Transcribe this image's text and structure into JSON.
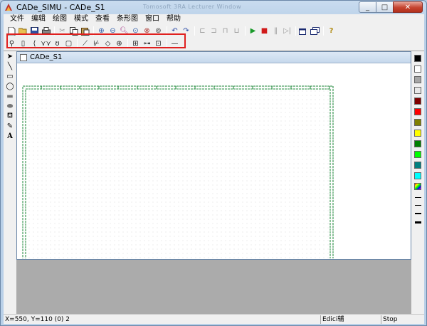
{
  "window": {
    "title": "CADe_SIMU - CADe_S1",
    "ghost_title": "Tomosoft 3RA Lecturer Window"
  },
  "menu": [
    "文件",
    "编辑",
    "绘图",
    "模式",
    "查看",
    "条形图",
    "窗口",
    "帮助"
  ],
  "document": {
    "title": "CADe_S1"
  },
  "status": {
    "coords": "X=550, Y=110 (0) 2",
    "mode": "Edici辅",
    "run_state": "Stop"
  },
  "colors": {
    "palette": [
      "#000000",
      "#ffffff",
      "#a6a6a6",
      "#e8e8e8",
      "#800000",
      "#ff0000",
      "#808000",
      "#ffff00",
      "#008000",
      "#00ff00",
      "#008080",
      "#00ffff"
    ],
    "highlight": "#e0201f",
    "border_green": "#1e8a3a"
  },
  "toolbar1": [
    "new-icon",
    "open-icon",
    "save-icon",
    "print-icon",
    "cut-icon",
    "copy-icon",
    "paste-icon",
    "zoom-in-icon",
    "zoom-out-icon",
    "zoom-fit-icon",
    "zoom-window-icon",
    "zoom-previous-icon",
    "undo-icon",
    "redo-icon",
    "align-left-icon",
    "align-center-icon",
    "align-right-icon",
    "align-top-icon",
    "play-icon",
    "stop-icon",
    "pause-icon",
    "step-icon",
    "window-icon",
    "window-cascade-icon",
    "help-icon"
  ],
  "toolbar2": [
    "component-power-icon",
    "component-fuse-icon",
    "component-switch-icon",
    "component-breaker-icon",
    "component-contactor-icon",
    "component-relay-icon",
    "component-contact-no-icon",
    "component-contact-nc-icon",
    "component-sensor-icon",
    "component-lamp-icon",
    "component-terminal-icon",
    "component-motor-icon",
    "component-meter-icon",
    "wire-icon"
  ],
  "tools": [
    "pointer-icon",
    "line-icon",
    "rectangle-icon",
    "ellipse-icon",
    "filled-rectangle-icon",
    "filled-ellipse-icon",
    "fill-icon",
    "pen-icon",
    "text-icon"
  ]
}
